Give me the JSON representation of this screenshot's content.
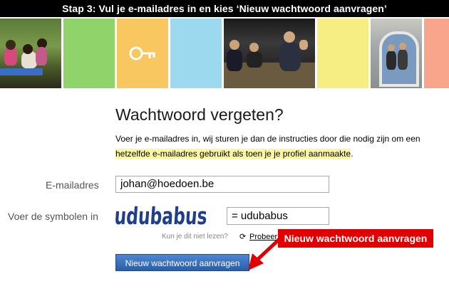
{
  "header": {
    "step_text": "Stap 3: Vul je e-mailadres in en kies ‘Nieuw wachtwoord aanvragen’"
  },
  "page": {
    "title": "Wachtwoord vergeten?",
    "intro_line1": "Voer je e-mailadres in, wij sturen je dan de instructies door die nodig zijn om een",
    "intro_highlight": "hetzelfde e-mailadres gebruikt als toen je je profiel aanmaakte",
    "intro_tail": "."
  },
  "form": {
    "email_label": "E-mailadres",
    "email_value": "johan@hoedoen.be",
    "symbols_label": "Voer de symbolen in",
    "captcha_text": "udubabus",
    "code_value": "= udubabus",
    "help_text": "Kun je dit niet lezen?",
    "retry_label": "Probeer",
    "submit_label": "Nieuw wachtwoord aanvragen"
  },
  "annotation": {
    "label": "Nieuw wachtwoord aanvragen"
  },
  "colors": {
    "topbar": "#000000",
    "tile_green": "#8fd36a",
    "tile_orange": "#f9c760",
    "tile_blue": "#9dd9ee",
    "tile_yellow": "#f6ee82",
    "tile_salmon": "#f8a58c",
    "highlight": "#fbf7a0",
    "button": "#3a6fbe",
    "annotation": "#e00000"
  }
}
